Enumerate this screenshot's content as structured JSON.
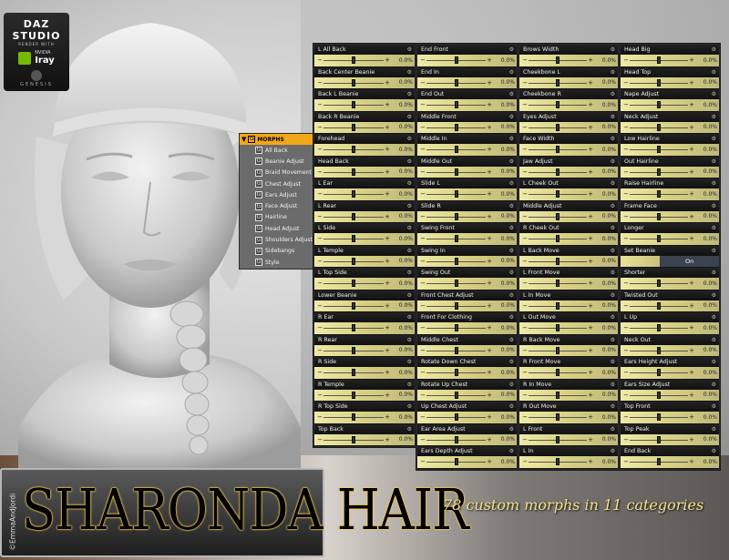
{
  "logo": {
    "brand": "DAZ STUDIO",
    "render_with": "RENDER WITH",
    "nvidia": "NVIDIA",
    "iray": "Iray",
    "genesis": "GENESIS"
  },
  "tree": {
    "header": "MORPHS",
    "items": [
      "All Back",
      "Beanie Adjust",
      "Braid Movement",
      "Chest Adjust",
      "Ears Adjust",
      "Face Adjust",
      "Hairline",
      "Head Adjust",
      "Shoulders Adjust",
      "Sidebangs",
      "Style"
    ]
  },
  "columns": [
    {
      "sliders": [
        {
          "label": "L All Back",
          "value": "0.0%"
        },
        {
          "label": "Back Center Beanie",
          "value": "0.0%"
        },
        {
          "label": "Back L Beanie",
          "value": "0.0%"
        },
        {
          "label": "Back R Beanie",
          "value": "0.0%"
        },
        {
          "label": "Forehead",
          "value": "0.0%"
        },
        {
          "label": "Head Back",
          "value": "0.0%"
        },
        {
          "label": "L Ear",
          "value": "0.0%"
        },
        {
          "label": "L Rear",
          "value": "0.0%"
        },
        {
          "label": "L Side",
          "value": "0.0%"
        },
        {
          "label": "L Temple",
          "value": "0.0%"
        },
        {
          "label": "L Top Side",
          "value": "0.0%"
        },
        {
          "label": "Lower Beanie",
          "value": "0.0%"
        },
        {
          "label": "R Ear",
          "value": "0.0%"
        },
        {
          "label": "R Rear",
          "value": "0.0%"
        },
        {
          "label": "R Side",
          "value": "0.0%"
        },
        {
          "label": "R Temple",
          "value": "0.0%"
        },
        {
          "label": "R Top Side",
          "value": "0.0%"
        },
        {
          "label": "Top Back",
          "value": "0.0%"
        }
      ]
    },
    {
      "sliders": [
        {
          "label": "End Front",
          "value": "0.0%"
        },
        {
          "label": "End In",
          "value": "0.0%"
        },
        {
          "label": "End Out",
          "value": "0.0%"
        },
        {
          "label": "Middle Front",
          "value": "0.0%"
        },
        {
          "label": "Middle In",
          "value": "0.0%"
        },
        {
          "label": "Middle Out",
          "value": "0.0%"
        },
        {
          "label": "Slide L",
          "value": "0.0%"
        },
        {
          "label": "Slide R",
          "value": "0.0%"
        },
        {
          "label": "Swing Front",
          "value": "0.0%"
        },
        {
          "label": "Swing In",
          "value": "0.0%"
        },
        {
          "label": "Swing Out",
          "value": "0.0%"
        },
        {
          "label": "Front Chest Adjust",
          "value": "0.0%"
        },
        {
          "label": "Front For Clothing",
          "value": "0.0%"
        },
        {
          "label": "Middle Chest",
          "value": "0.0%"
        },
        {
          "label": "Rotate Down Chest",
          "value": "0.0%"
        },
        {
          "label": "Rotate Up Chest",
          "value": "0.0%"
        },
        {
          "label": "Up Chest Adjust",
          "value": "0.0%"
        },
        {
          "label": "Ear Area Adjust",
          "value": "0.0%"
        },
        {
          "label": "Ears Depth Adjust",
          "value": "0.0%"
        }
      ]
    },
    {
      "sliders": [
        {
          "label": "Brows Width",
          "value": "0.0%"
        },
        {
          "label": "Cheekbone L",
          "value": "0.0%"
        },
        {
          "label": "Cheekbone R",
          "value": "0.0%"
        },
        {
          "label": "Eyes Adjust",
          "value": "0.0%"
        },
        {
          "label": "Face Width",
          "value": "0.0%"
        },
        {
          "label": "Jaw Adjust",
          "value": "0.0%"
        },
        {
          "label": "L Cheek Out",
          "value": "0.0%"
        },
        {
          "label": "Middle Adjust",
          "value": "0.0%"
        },
        {
          "label": "R Cheek Out",
          "value": "0.0%"
        },
        {
          "label": "L Back Move",
          "value": "0.0%"
        },
        {
          "label": "L Front Move",
          "value": "0.0%"
        },
        {
          "label": "L In Move",
          "value": "0.0%"
        },
        {
          "label": "L Out Move",
          "value": "0.0%"
        },
        {
          "label": "R Back Move",
          "value": "0.0%"
        },
        {
          "label": "R Front Move",
          "value": "0.0%"
        },
        {
          "label": "R In Move",
          "value": "0.0%"
        },
        {
          "label": "R Out Move",
          "value": "0.0%"
        },
        {
          "label": "L Front",
          "value": "0.0%"
        },
        {
          "label": "L In",
          "value": "0.0%"
        }
      ]
    },
    {
      "sliders": [
        {
          "label": "Head Big",
          "value": "0.0%"
        },
        {
          "label": "Head Top",
          "value": "0.0%"
        },
        {
          "label": "Nape Adjust",
          "value": "0.0%"
        },
        {
          "label": "Neck Adjust",
          "value": "0.0%"
        },
        {
          "label": "Low Hairline",
          "value": "0.0%"
        },
        {
          "label": "Out Hairline",
          "value": "0.0%"
        },
        {
          "label": "Raise Hairline",
          "value": "0.0%"
        },
        {
          "label": "Frame Face",
          "value": "0.0%"
        },
        {
          "label": "Longer",
          "value": "0.0%"
        },
        {
          "label": "Set Beanie",
          "toggle": "On"
        },
        {
          "label": "Shorter",
          "value": "0.0%"
        },
        {
          "label": "Twisted Out",
          "value": "0.0%"
        },
        {
          "label": "L Up",
          "value": "0.0%"
        },
        {
          "label": "Neck Out",
          "value": "0.0%"
        },
        {
          "label": "Ears Height Adjust",
          "value": "0.0%"
        },
        {
          "label": "Ears Size Adjust",
          "value": "0.0%"
        },
        {
          "label": "Top Front",
          "value": "0.0%"
        },
        {
          "label": "Top Peak",
          "value": "0.0%"
        },
        {
          "label": "End Back",
          "value": "0.0%"
        }
      ]
    }
  ],
  "title": "SHARONDA HAIR",
  "subtitle": "78 custom morphs in 11 categories",
  "credit": "©EmmaAndJordi",
  "colors": {
    "slider_fill": "#efeaa6",
    "accent": "#f1a818",
    "panel_bg": "#2c2c2c"
  }
}
